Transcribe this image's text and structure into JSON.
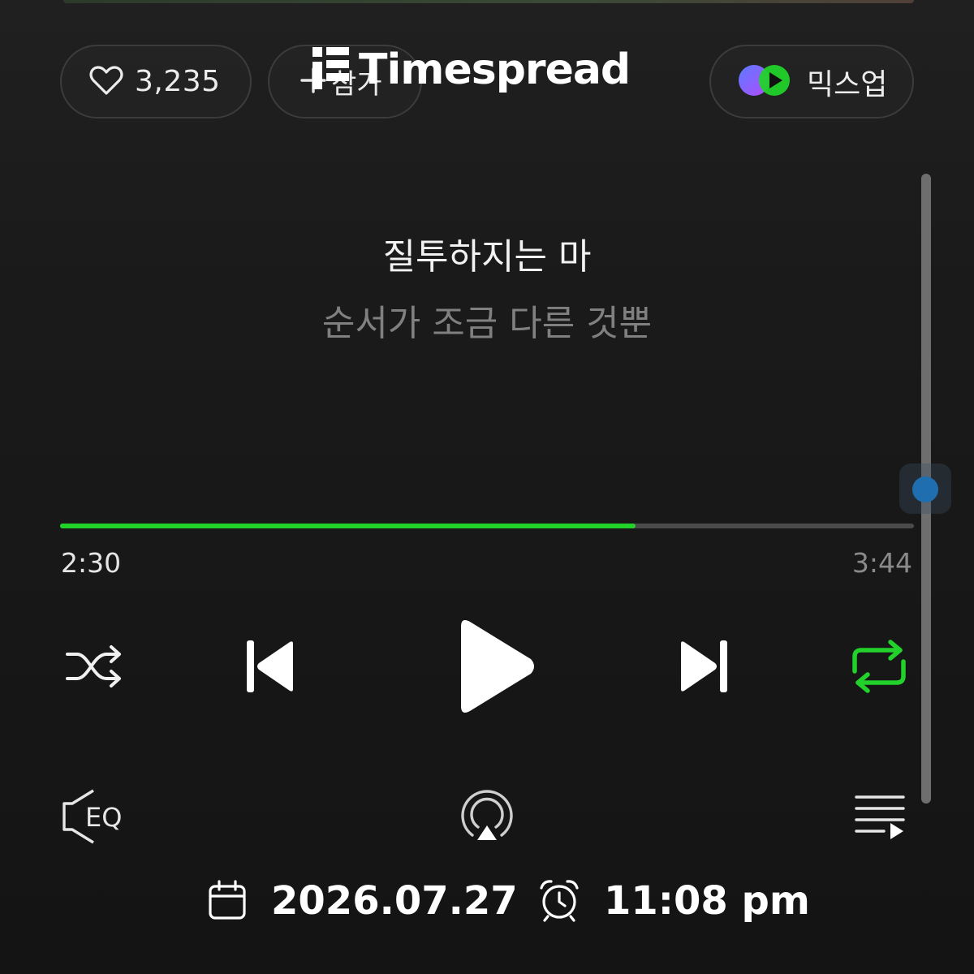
{
  "header": {
    "like_count": "3,235",
    "join_label": "참가",
    "mixup_label": "믹스업"
  },
  "watermark": {
    "text": "Timespread"
  },
  "lyrics": {
    "current": "질투하지는 마",
    "next": "순서가 조금 다른 것뿐"
  },
  "player": {
    "elapsed": "2:30",
    "duration": "3:44",
    "progress_fraction": 0.674,
    "shuffle_icon": "shuffle-icon",
    "prev_icon": "skip-previous-icon",
    "play_icon": "play-icon",
    "next_icon": "skip-next-icon",
    "repeat_icon": "repeat-icon",
    "repeat_active": true
  },
  "toolbar": {
    "eq_label": "EQ",
    "cast_icon": "airplay-icon",
    "playlist_icon": "playlist-icon"
  },
  "footer": {
    "date": "2026.07.27",
    "time": "11:08 pm"
  },
  "colors": {
    "accent": "#22d22b",
    "scroll_thumb": "#1f6fb0",
    "background": "#161616"
  }
}
